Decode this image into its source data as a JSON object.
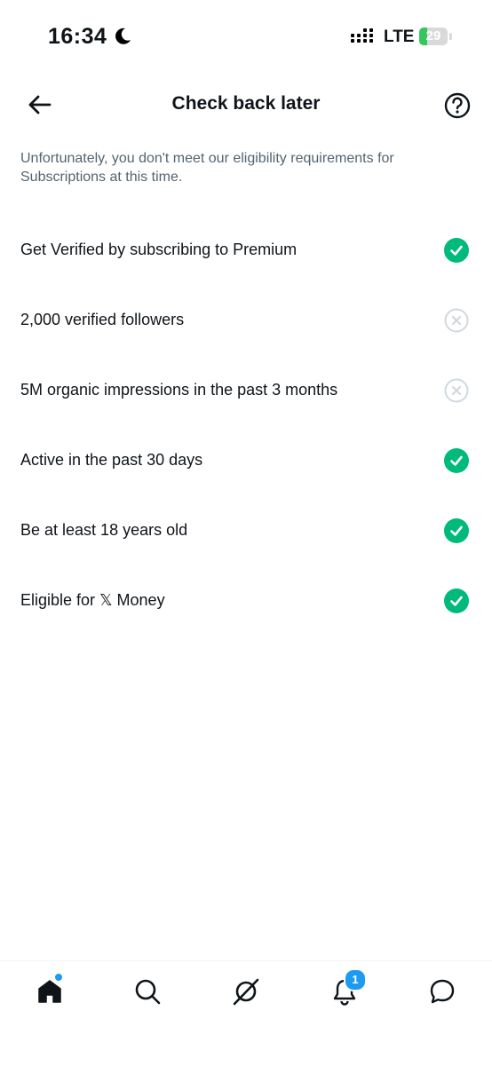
{
  "status_bar": {
    "time": "16:34",
    "network": "LTE",
    "battery_level": "29",
    "icons": [
      "moon-icon",
      "signal-icon",
      "battery-icon"
    ]
  },
  "header": {
    "title": "Check back later",
    "back_icon": "arrow-left-icon",
    "help_icon": "question-circle-icon"
  },
  "description": "Unfortunately, you don't meet our eligibility requirements for Subscriptions at this time.",
  "requirements": [
    {
      "label": "Get Verified by subscribing to Premium",
      "met": true
    },
    {
      "label": "2,000 verified followers",
      "met": false
    },
    {
      "label": "5M organic impressions in the past 3 months",
      "met": false
    },
    {
      "label": "Active in the past 30 days",
      "met": true
    },
    {
      "label": "Be at least 18 years old",
      "met": true
    },
    {
      "label": "Eligible for 𝕏 Money",
      "met": true
    }
  ],
  "bottom_nav": {
    "items": [
      "home-icon",
      "search-icon",
      "grok-icon",
      "bell-icon",
      "messages-icon"
    ],
    "notifications_count": "1"
  },
  "colors": {
    "met": "#00ba7c",
    "unmet": "#cfd9de",
    "accent": "#1d9bf0",
    "secondary_text": "#536471"
  }
}
